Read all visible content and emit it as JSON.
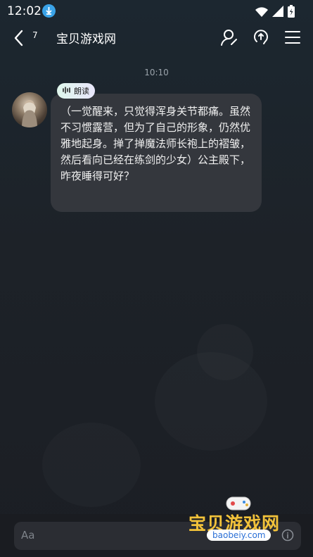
{
  "status": {
    "time": "12:02"
  },
  "nav": {
    "unread_count": "7",
    "title": "宝贝游戏网"
  },
  "chat": {
    "timestamp": "10:10",
    "read_aloud_label": "朗读",
    "message": "（一觉醒来，只觉得浑身关节都痛。虽然不习惯露营，但为了自己的形象，仍然优雅地起身。掸了掸魔法师长袍上的褶皱，然后看向已经在练剑的少女）公主殿下，昨夜睡得可好？"
  },
  "input": {
    "placeholder": "Aa"
  },
  "watermark": {
    "title": "宝贝游戏网",
    "url": "baobeiy.com"
  }
}
